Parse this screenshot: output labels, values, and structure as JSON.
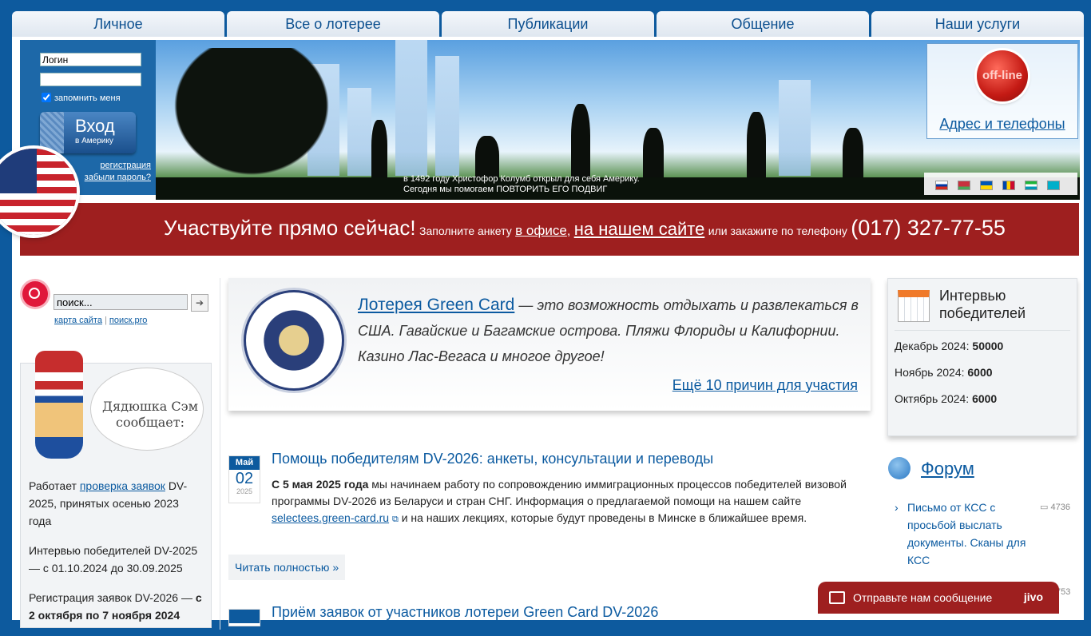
{
  "nav": [
    "Личное",
    "Все о лотерее",
    "Публикации",
    "Общение",
    "Наши услуги"
  ],
  "login": {
    "username_value": "Логин",
    "password_value": "",
    "remember_label": "запомнить меня",
    "button_big": "Вход",
    "button_small": "в Америку",
    "register": "регистрация",
    "forgot": "забыли пароль?"
  },
  "banner": {
    "caption1": "в 1492 году Христофор Колумб открыл для себя Америку.",
    "caption2": "Сегодня мы помогаем ПОВТОРИТЬ ЕГО ПОДВИГ",
    "status": "off-line",
    "address_link": "Адрес и телефоны"
  },
  "cta": {
    "headline": "Участвуйте прямо сейчас!",
    "t1": "Заполните анкету",
    "office": "в офисе",
    "comma": ",",
    "site": "на нашем сайте",
    "t2": "или закажите по телефону",
    "phone": "(017) 327-77-55"
  },
  "search": {
    "placeholder": "поиск...",
    "go": "➔",
    "link1": "карта сайта",
    "sep": "|",
    "link2": "поиск.pro"
  },
  "sam": {
    "bubble": "Дядюшка Сэм сообщает:",
    "n1_pre": "Работает",
    "n1_link": "проверка заявок",
    "n1_post": "DV-2025, принятых осенью 2023 года",
    "n2": "Интервью победителей DV-2025 — с 01.10.2024 до 30.09.2025",
    "n3_pre": "Регистрация заявок DV-2026 —",
    "n3_bold": "с 2 октября по 7 ноября 2024"
  },
  "greencard": {
    "link": "Лотерея Green Card",
    "text": " — это возможность отдыхать и развлекаться в США. Гавайские и Багамские острова. Пляжи Флориды и Калифорнии. Казино Лас-Вегаса и многое другое!",
    "more": "Ещё 10 причин для участия"
  },
  "news": [
    {
      "month": "Май",
      "day": "02",
      "year": "2025",
      "title": "Помощь победителям DV-2026: анкеты, консультации и переводы",
      "bold": "С 5 мая 2025 года",
      "text": " мы начинаем работу по сопровождению иммиграционных процессов победителей визовой программы DV-2026 из Беларуси и стран СНГ. Информация о предлагаемой помощи на нашем сайте ",
      "link": "selectees.green-card.ru",
      "text2": " и на наших лекциях, которые будут проведены в Минске в ближайшее время.",
      "read_more": "Читать полностью »"
    },
    {
      "title": "Приём заявок от участников лотереи Green Card DV-2026"
    }
  ],
  "interview": {
    "title": "Интервью победителей",
    "rows": [
      {
        "label": "Декабрь 2024:",
        "value": "50000"
      },
      {
        "label": "Ноябрь 2024:",
        "value": "6000"
      },
      {
        "label": "Октябрь 2024:",
        "value": "6000"
      }
    ]
  },
  "forum": {
    "title": "Форум",
    "items": [
      {
        "text": "Письмо от КСС с просьбой выслать документы. Сканы для КСС",
        "count": "4736"
      },
      {
        "count": "753"
      }
    ]
  },
  "chat": {
    "label": "Отправьте нам сообщение",
    "brand": "jivo"
  },
  "colors": {
    "page_bg": "#0d5a9e",
    "red_bar": "#9e1f1f",
    "link": "#0b5aa0"
  }
}
